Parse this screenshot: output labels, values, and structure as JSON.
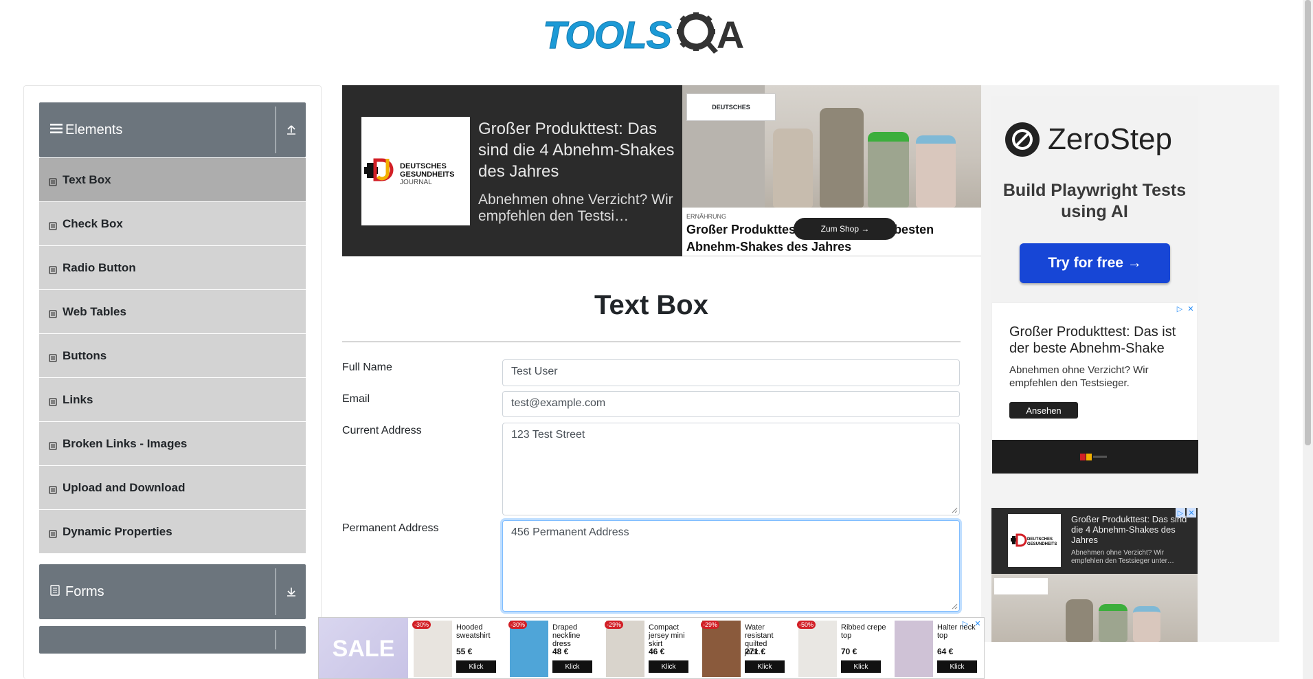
{
  "header": {
    "logo_text": "TOOLS",
    "logo_suffix": "A"
  },
  "sidebar": {
    "groups": [
      {
        "label": "Elements",
        "icon": "hamburger-icon",
        "toggle": "collapse-arrow-icon"
      },
      {
        "label": "Forms",
        "icon": "document-icon",
        "toggle": "expand-arrow-icon"
      }
    ],
    "items": [
      {
        "label": "Text Box",
        "active": true
      },
      {
        "label": "Check Box"
      },
      {
        "label": "Radio Button"
      },
      {
        "label": "Web Tables"
      },
      {
        "label": "Buttons"
      },
      {
        "label": "Links"
      },
      {
        "label": "Broken Links - Images"
      },
      {
        "label": "Upload and Download"
      },
      {
        "label": "Dynamic Properties"
      }
    ]
  },
  "ad_top": {
    "brand_line1": "DEUTSCHES",
    "brand_line2": "GESUNDHEITS",
    "brand_line3": "JOURNAL",
    "headline": "Großer Produkttest: Das sind die 4 Abnehm-Shakes des Jahres",
    "sub": "Abnehmen ohne Verzicht? Wir empfehlen den Testsi…",
    "category": "ERNÄHRUNG",
    "caption": "Großer Produkttest: Das sind die 4 besten Abnehm-Shakes des Jahres",
    "shop_button": "Zum Shop →"
  },
  "main": {
    "title": "Text Box",
    "fields": {
      "full_name_label": "Full Name",
      "full_name_value": "Test User",
      "email_label": "Email",
      "email_value": "test@example.com",
      "current_address_label": "Current Address",
      "current_address_value": "123 Test Street",
      "permanent_address_label": "Permanent Address",
      "permanent_address_value": "456 Permanent Address"
    }
  },
  "ad_zerostep": {
    "brand": "ZeroStep",
    "tagline": "Build Playwright Tests using AI",
    "button": "Try for free →"
  },
  "ad_right2": {
    "headline": "Großer Produkttest: Das ist der beste Abnehm-Shake",
    "sub": "Abnehmen ohne Verzicht? Wir empfehlen den Testsieger.",
    "button": "Ansehen"
  },
  "ad_right3": {
    "headline": "Großer Produkttest: Das sind die 4 Abnehm-Shakes des Jahres",
    "sub": "Abnehmen ohne Verzicht? Wir empfehlen den Testsieger unter…"
  },
  "sale_banner": {
    "label": "SALE",
    "products": [
      {
        "name": "Hooded sweatshirt",
        "price": "55 €",
        "badge": "-30%",
        "button": "Klick"
      },
      {
        "name": "Draped neckline dress",
        "price": "48 €",
        "badge": "-30%",
        "button": "Klick"
      },
      {
        "name": "Compact jersey mini skirt",
        "price": "46 €",
        "badge": "-29%",
        "button": "Klick"
      },
      {
        "name": "Water resistant quilted jack…",
        "price": "271 €",
        "badge": "-29%",
        "button": "Klick"
      },
      {
        "name": "Ribbed crepe top",
        "price": "70 €",
        "badge": "-50%",
        "button": "Klick"
      },
      {
        "name": "Halter neck top",
        "price": "64 €",
        "badge": "",
        "button": "Klick"
      }
    ]
  },
  "colors": {
    "accent": "#1c9ad6",
    "sidebar_header": "#6c757d",
    "menu_item": "#d3d3d3",
    "zerostep_button": "#1746d6"
  }
}
